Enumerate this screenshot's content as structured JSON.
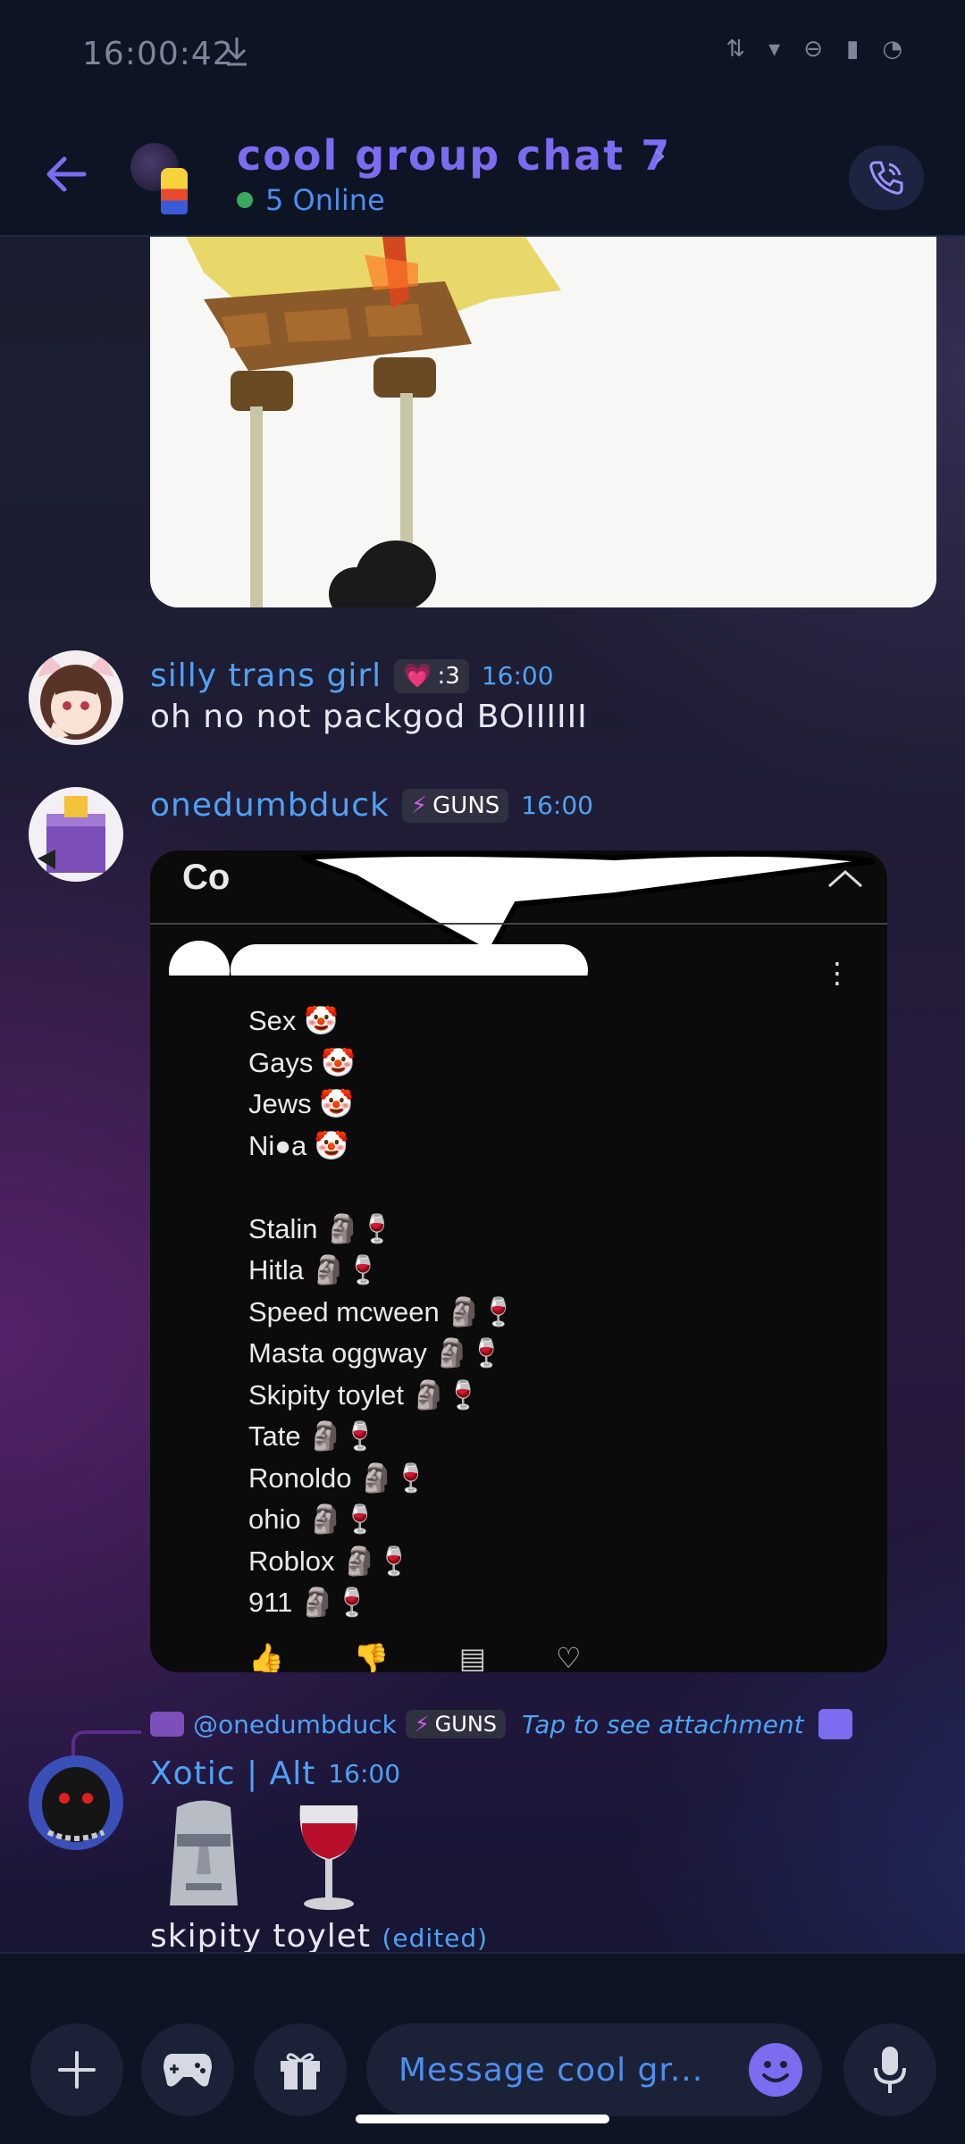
{
  "status_bar": {
    "time": "16:00:42"
  },
  "header": {
    "title": "cool group chat 7",
    "online": "5 Online"
  },
  "messages": [
    {
      "author": "silly trans girl",
      "tag": ":3",
      "time": "16:00",
      "text": "oh no not packgod BOIIIIII"
    },
    {
      "author": "onedumbduck",
      "tag": "GUNS",
      "time": "16:00"
    },
    {
      "author": "Xotic | Alt",
      "time": "16:00",
      "reply_mention": "@onedumbduck",
      "reply_tag": "GUNS",
      "reply_hint": "Tap to see attachment",
      "text": "skipity toylet",
      "edited": "(edited)"
    }
  ],
  "attachment_lines": [
    "Sex 🤡",
    "Gays 🤡",
    "Jews 🤡",
    "Ni●a 🤡",
    "",
    "Stalin 🗿🍷",
    "Hitla 🗿🍷",
    "Speed mcween 🗿🍷",
    "Masta oggway 🗿🍷",
    "Skipity toylet 🗿🍷",
    "Tate 🗿🍷",
    "Ronoldo 🗿🍷",
    "ohio 🗿🍷",
    "Roblox 🗿🍷",
    "911 🗿🍷"
  ],
  "attachment_header": "Co",
  "composer": {
    "placeholder": "Message cool gr..."
  },
  "colors": {
    "accent": "#7b6cf0",
    "link": "#4fa2f5",
    "online": "#3aa85d"
  }
}
